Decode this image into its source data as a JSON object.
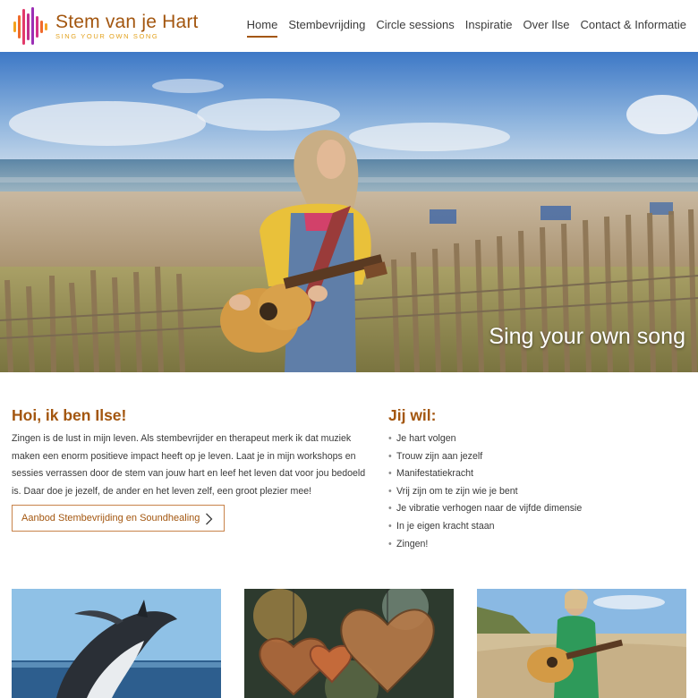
{
  "brand": {
    "title": "Stem van je Hart",
    "subtitle": "SING YOUR OWN SONG"
  },
  "nav": {
    "items": [
      "Home",
      "Stembevrijding",
      "Circle sessions",
      "Inspiratie",
      "Over Ilse",
      "Contact & Informatie"
    ],
    "active": "Home"
  },
  "hero": {
    "tagline": "Sing your own song"
  },
  "intro": {
    "heading": "Hoi, ik ben Ilse!",
    "text": "Zingen is de lust in mijn leven. Als stembevrijder en therapeut merk ik dat muziek maken een enorm positieve impact heeft op je leven. Laat je in mijn workshops en sessies verrassen door de stem van jouw hart en leef het leven dat voor jou bedoeld is. Daar doe je jezelf, de ander en het leven zelf, een groot plezier mee!",
    "cta_label": "Aanbod Stembevrijding en Soundhealing"
  },
  "wishes": {
    "heading": "Jij wil:",
    "items": [
      "Je hart volgen",
      "Trouw zijn aan jezelf",
      "Manifestatiekracht",
      "Vrij zijn om te zijn wie je bent",
      "Je vibratie verhogen naar de vijfde dimensie",
      "In je eigen kracht staan",
      "Zingen!"
    ]
  },
  "colors": {
    "accent": "#a3560f",
    "sub_accent": "#e3a21e"
  },
  "icons": {
    "logo": "sound-wave-logo-icon",
    "cta": "chevron-right-icon"
  }
}
